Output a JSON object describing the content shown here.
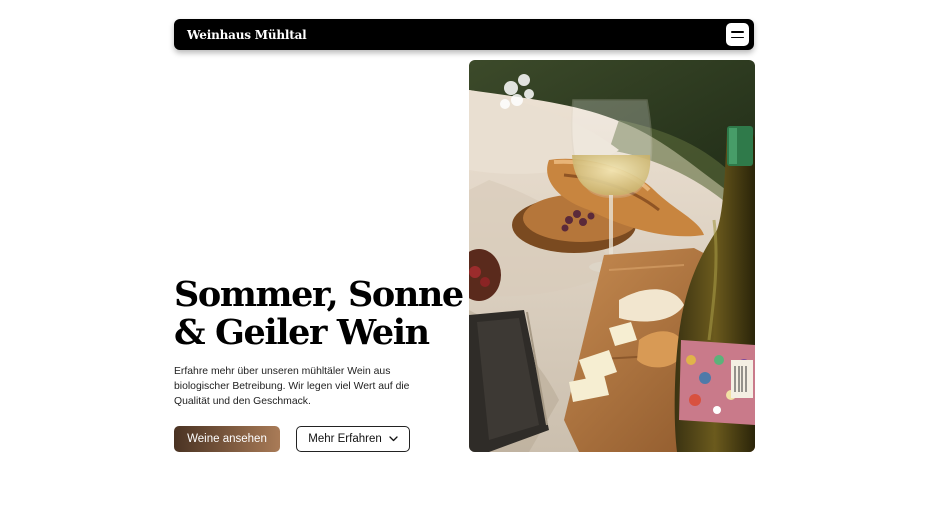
{
  "header": {
    "brand": "Weinhaus Mühltal",
    "menu_icon": "hamburger-menu-icon"
  },
  "hero": {
    "headline_line1": "Sommer, Sonne",
    "headline_line2": "& Geiler Wein",
    "description": "Erfahre mehr über unseren mühltäler Wein aus biologischer Betreibung. Wir legen viel Wert auf die Qualität und den Geschmack.",
    "primary_button": "Weine ansehen",
    "secondary_button": "Mehr Erfahren",
    "secondary_icon": "chevron-down-icon",
    "image_icon": "picnic-wine-photo"
  },
  "colors": {
    "navbar": "#000000",
    "primary_gradient_start": "#4a3323",
    "primary_gradient_end": "#a97b57"
  }
}
